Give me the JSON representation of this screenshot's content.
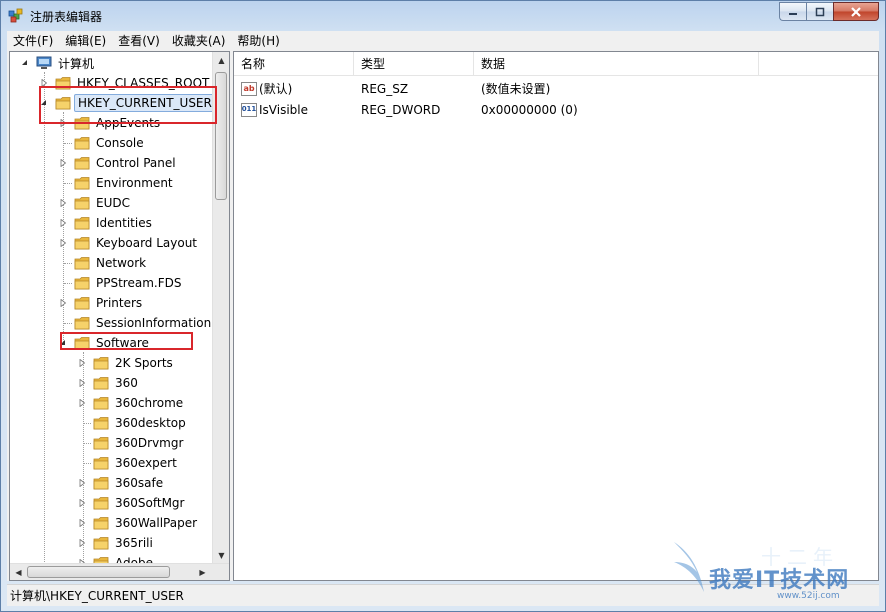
{
  "window": {
    "title": "注册表编辑器",
    "icon": "registry-editor-icon"
  },
  "menu": [
    {
      "label": "文件(F)"
    },
    {
      "label": "编辑(E)"
    },
    {
      "label": "查看(V)"
    },
    {
      "label": "收藏夹(A)"
    },
    {
      "label": "帮助(H)"
    }
  ],
  "tree": {
    "root": "计算机",
    "hives": [
      {
        "label": "HKEY_CLASSES_ROOT"
      },
      {
        "label": "HKEY_CURRENT_USER"
      }
    ],
    "hkcu_children": [
      {
        "label": "AppEvents"
      },
      {
        "label": "Console"
      },
      {
        "label": "Control Panel"
      },
      {
        "label": "Environment"
      },
      {
        "label": "EUDC"
      },
      {
        "label": "Identities"
      },
      {
        "label": "Keyboard Layout"
      },
      {
        "label": "Network"
      },
      {
        "label": "PPStream.FDS"
      },
      {
        "label": "Printers"
      },
      {
        "label": "SessionInformation"
      },
      {
        "label": "Software"
      }
    ],
    "software_children": [
      {
        "label": "2K Sports"
      },
      {
        "label": "360"
      },
      {
        "label": "360chrome"
      },
      {
        "label": "360desktop"
      },
      {
        "label": "360Drvmgr"
      },
      {
        "label": "360expert"
      },
      {
        "label": "360safe"
      },
      {
        "label": "360SoftMgr"
      },
      {
        "label": "360WallPaper"
      },
      {
        "label": "365rili"
      },
      {
        "label": "Adobe"
      }
    ]
  },
  "list": {
    "columns": {
      "name": "名称",
      "type": "类型",
      "data": "数据"
    },
    "rows": [
      {
        "icon": "string-value-icon",
        "icon_glyph": "ab",
        "name": "(默认)",
        "type": "REG_SZ",
        "data": "(数值未设置)"
      },
      {
        "icon": "dword-value-icon",
        "icon_glyph": "011",
        "name": "IsVisible",
        "type": "REG_DWORD",
        "data": "0x00000000 (0)"
      }
    ]
  },
  "status": "计算机\\HKEY_CURRENT_USER",
  "watermark": {
    "top": "十二年",
    "main": "我爱IT技术网",
    "url": "www.52ij.com"
  },
  "colors": {
    "highlight_box": "#d9262b",
    "folder": "#f2c94c",
    "selection": "#dbe8f8"
  }
}
